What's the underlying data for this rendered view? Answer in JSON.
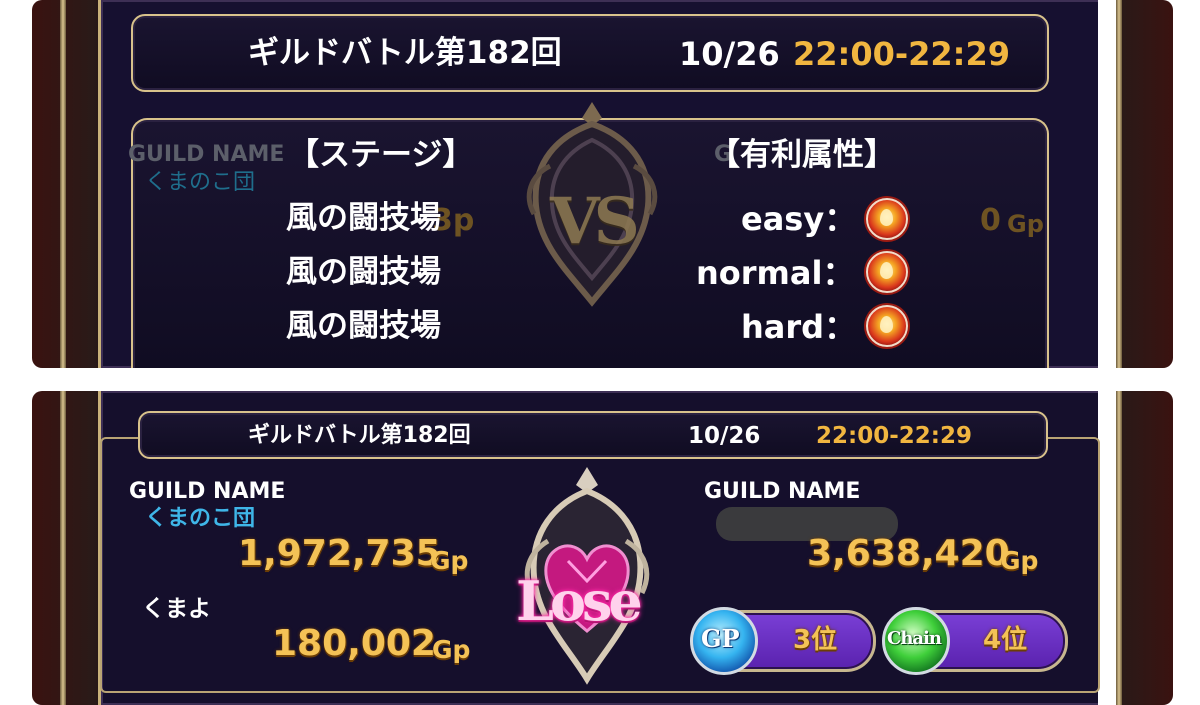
{
  "top": {
    "battle_title": "ギルドバトル第182回",
    "date": "10/26",
    "time": "22:00-22:29",
    "behind_guild_name_label": "GUILD NAME",
    "behind_guild_name_right": "G",
    "behind_guild_value": "くまのこ団",
    "behind_gp_left": "3p",
    "behind_gp_right": "0",
    "behind_gp_unit": "Gp",
    "stage_header": "【ステージ】",
    "attr_header": "【有利属性】",
    "stages": [
      "風の闘技場",
      "風の闘技場",
      "風の闘技場"
    ],
    "difficulties": [
      "easy：",
      "normal：",
      "hard："
    ],
    "vs_label": "VS",
    "attribute_icon": "fire-attribute-icon"
  },
  "bottom": {
    "battle_title": "ギルドバトル第182回",
    "date": "10/26",
    "time": "22:00-22:29",
    "left_guild_label": "GUILD NAME",
    "left_guild_name": "くまのこ団",
    "left_guild_gp": "1,972,735",
    "gp_unit": "Gp",
    "player_name": "くまよ",
    "player_gp": "180,002",
    "right_guild_label": "GUILD NAME",
    "right_guild_gp": "3,638,420",
    "result": "Lose",
    "gp_badge_label": "GP",
    "gp_rank": "3位",
    "chain_badge_label": "Chain",
    "chain_rank": "4位"
  },
  "colors": {
    "gold": "#f1b640",
    "panel": "#161030",
    "guild_blue": "#3fb6e8",
    "lose_pink": "#ff6fb8"
  }
}
